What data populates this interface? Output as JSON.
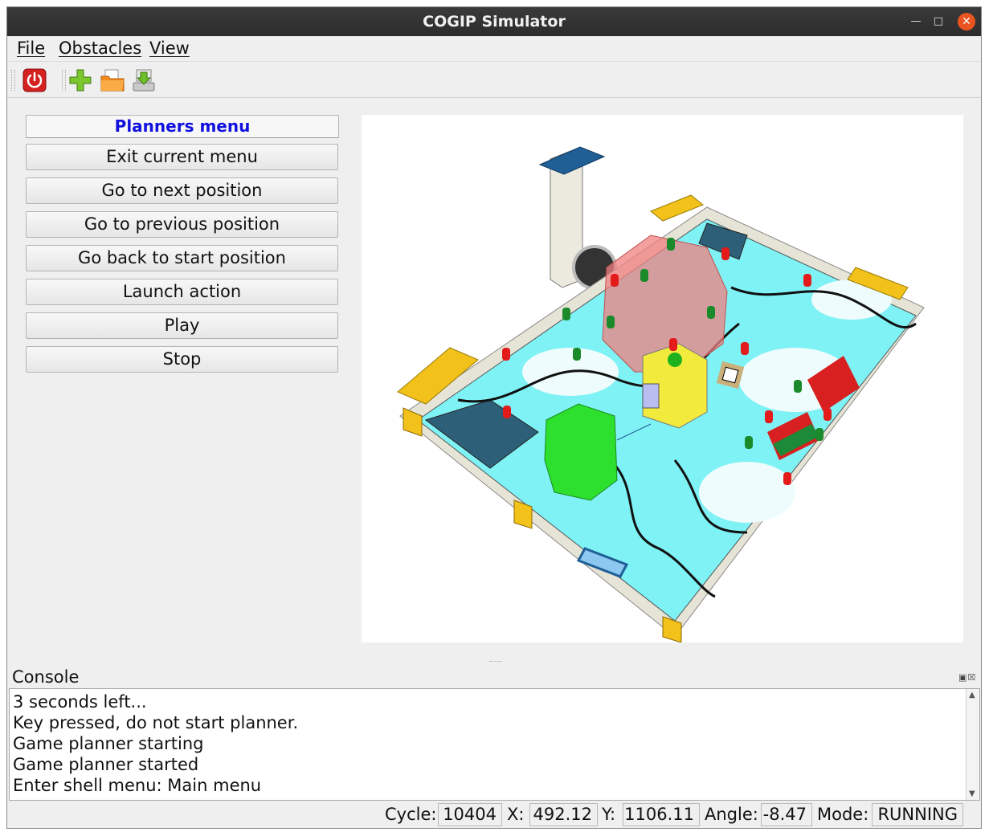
{
  "window": {
    "title": "COGIP Simulator"
  },
  "menubar": {
    "items": [
      {
        "label": "File"
      },
      {
        "label": "Obstacles"
      },
      {
        "label": "View"
      }
    ]
  },
  "toolbar": {
    "buttons": [
      "power-icon",
      "add-icon",
      "open-folder-icon",
      "save-download-icon"
    ]
  },
  "planner": {
    "header": "Planners menu",
    "buttons": [
      {
        "label": "Exit current menu"
      },
      {
        "label": "Go to next position"
      },
      {
        "label": "Go to previous position"
      },
      {
        "label": "Go back to start position"
      },
      {
        "label": "Launch action"
      },
      {
        "label": "Play"
      },
      {
        "label": "Stop"
      }
    ]
  },
  "console": {
    "title": "Console",
    "lines": [
      "3 seconds left...",
      "Key pressed, do not start planner.",
      "Game planner starting",
      "Game planner started",
      "Enter shell menu: Main menu"
    ]
  },
  "status": {
    "cycle_label": "Cycle:",
    "cycle": "10404",
    "x_label": "X:",
    "x": "492.12",
    "y_label": "Y:",
    "y": "1106.11",
    "angle_label": "Angle:",
    "angle": "-8.47",
    "mode_label": "Mode:",
    "mode": "RUNNING"
  },
  "colors": {
    "header_text": "#1010e0",
    "close_button": "#e95420",
    "field_water": "#7ef2f5",
    "robot_green": "#2de02d",
    "robot_yellow": "#f2ea3c",
    "obstacle_red": "#f08080"
  }
}
